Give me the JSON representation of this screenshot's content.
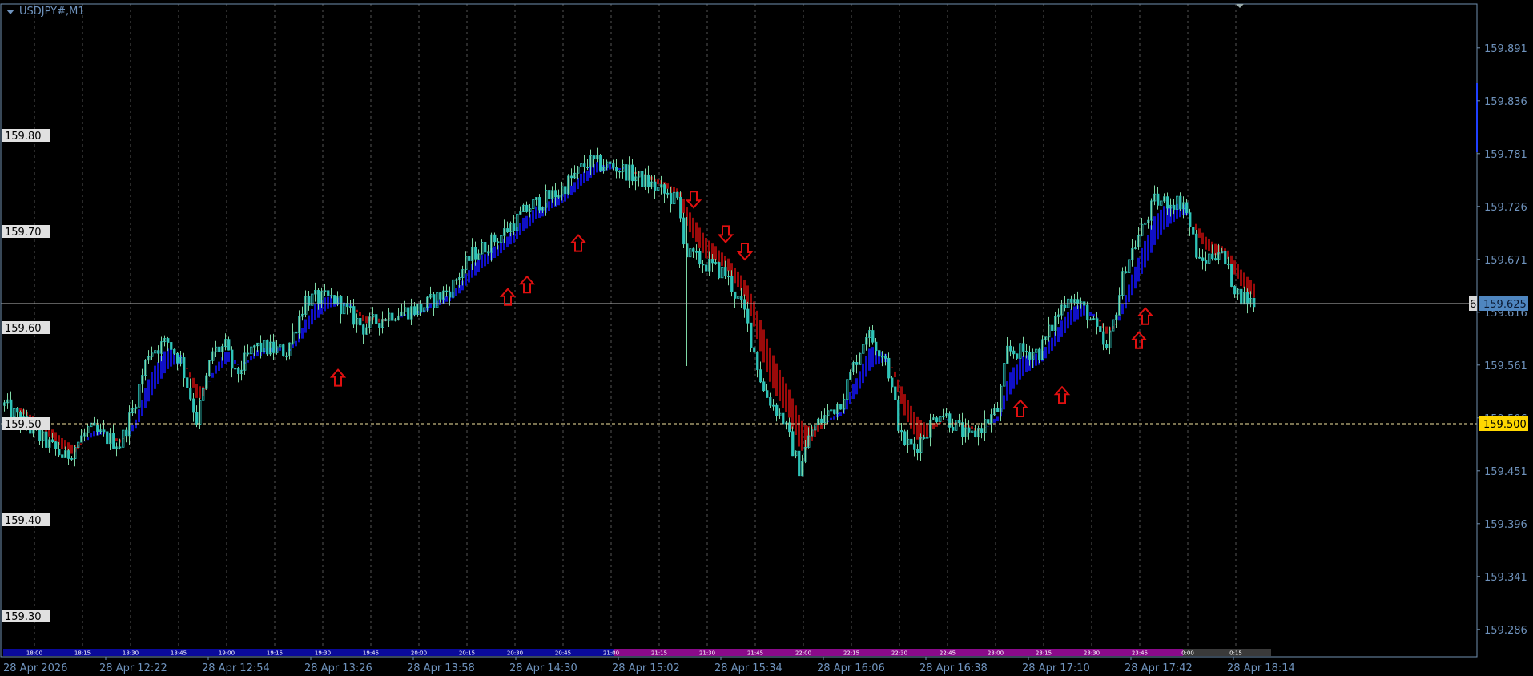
{
  "header": {
    "symbol_label": "USDJPY#,M1"
  },
  "chart_data": {
    "type": "candlestick",
    "title": "USDJPY#,M1",
    "ylim": [
      159.2667,
      159.9471
    ],
    "right_axis_ticks": [
      "159.891",
      "159.836",
      "159.781",
      "159.726",
      "159.671",
      "159.616",
      "159.561",
      "159.506",
      "159.451",
      "159.396",
      "159.341",
      "159.286"
    ],
    "left_level_labels": [
      "159.80",
      "159.70",
      "159.60",
      "159.50",
      "159.40",
      "159.30"
    ],
    "current_price": {
      "label": "159.625",
      "value": 159.625,
      "marker": "6",
      "color": "#4f86c0"
    },
    "level_line": {
      "label": "159.500",
      "value": 159.5,
      "color": "#ffd700"
    },
    "x_time_labels": [
      "28 Apr 2026",
      "28 Apr 12:22",
      "28 Apr 12:54",
      "28 Apr 13:26",
      "28 Apr 13:58",
      "28 Apr 14:30",
      "28 Apr 15:02",
      "28 Apr 15:34",
      "28 Apr 16:06",
      "28 Apr 16:38",
      "28 Apr 17:10",
      "28 Apr 17:42",
      "28 Apr 18:14"
    ],
    "session_bar_labels": [
      "18:00",
      "18:15",
      "18:30",
      "18:45",
      "19:00",
      "19:15",
      "19:30",
      "19:45",
      "20:00",
      "20:15",
      "20:30",
      "20:45",
      "21:00",
      "21:15",
      "21:30",
      "21:45",
      "22:00",
      "22:15",
      "22:30",
      "22:45",
      "23:00",
      "23:15",
      "23:30",
      "23:45",
      "0:00",
      "0:15"
    ],
    "session_colors": [
      "#0a0a9a",
      "#8a0a8a",
      "#3a3a3a"
    ],
    "price_path_minutes_price": [
      [
        0,
        159.519
      ],
      [
        8,
        159.494
      ],
      [
        19,
        159.464
      ],
      [
        26,
        159.494
      ],
      [
        36,
        159.479
      ],
      [
        40,
        159.514
      ],
      [
        45,
        159.575
      ],
      [
        51,
        159.585
      ],
      [
        55,
        159.565
      ],
      [
        60,
        159.504
      ],
      [
        65,
        159.575
      ],
      [
        69,
        159.58
      ],
      [
        72,
        159.549
      ],
      [
        78,
        159.58
      ],
      [
        88,
        159.575
      ],
      [
        94,
        159.63
      ],
      [
        103,
        159.63
      ],
      [
        112,
        159.6
      ],
      [
        121,
        159.615
      ],
      [
        130,
        159.62
      ],
      [
        139,
        159.64
      ],
      [
        146,
        159.676
      ],
      [
        155,
        159.696
      ],
      [
        164,
        159.726
      ],
      [
        173,
        159.741
      ],
      [
        182,
        159.772
      ],
      [
        191,
        159.767
      ],
      [
        200,
        159.752
      ],
      [
        210,
        159.731
      ],
      [
        213,
        159.676
      ],
      [
        219,
        159.666
      ],
      [
        225,
        159.656
      ],
      [
        231,
        159.615
      ],
      [
        237,
        159.534
      ],
      [
        243,
        159.504
      ],
      [
        248,
        159.454
      ],
      [
        252,
        159.494
      ],
      [
        261,
        159.524
      ],
      [
        269,
        159.595
      ],
      [
        275,
        159.57
      ],
      [
        280,
        159.484
      ],
      [
        284,
        159.474
      ],
      [
        292,
        159.514
      ],
      [
        301,
        159.484
      ],
      [
        310,
        159.514
      ],
      [
        313,
        159.575
      ],
      [
        323,
        159.575
      ],
      [
        332,
        159.635
      ],
      [
        338,
        159.615
      ],
      [
        344,
        159.575
      ],
      [
        350,
        159.666
      ],
      [
        359,
        159.731
      ],
      [
        368,
        159.731
      ],
      [
        373,
        159.666
      ],
      [
        379,
        159.681
      ],
      [
        385,
        159.635
      ],
      [
        390,
        159.625
      ]
    ],
    "signals_up": [
      [
        104,
        159.547
      ],
      [
        157,
        159.631
      ],
      [
        163,
        159.644
      ],
      [
        179,
        159.687
      ],
      [
        317,
        159.515
      ],
      [
        330,
        159.529
      ],
      [
        354,
        159.586
      ],
      [
        356,
        159.611
      ]
    ],
    "signals_down": [
      [
        215,
        159.734
      ],
      [
        225,
        159.698
      ],
      [
        231,
        159.68
      ]
    ],
    "colors": {
      "candle": "#2fc4b8",
      "wick": "#7fd8a6",
      "ribbon_up": "#1010c8",
      "ribbon_down": "#9a0a0a",
      "signal": "#e01010",
      "axis_text": "#6f93bd",
      "grid": "#555555"
    }
  }
}
